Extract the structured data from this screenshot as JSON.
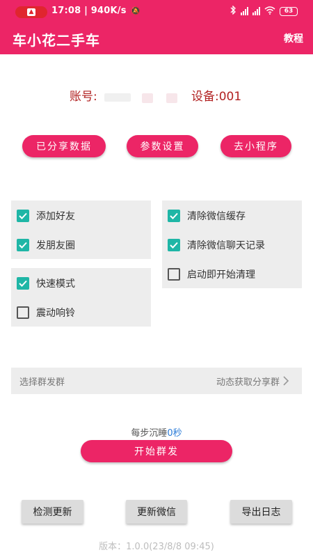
{
  "status_bar": {
    "time_speed": "17:08 | 940K/s",
    "battery": "63",
    "icons": [
      "record-icon",
      "mute-bell-icon",
      "bluetooth-icon",
      "signal-icon",
      "wifi-icon",
      "battery-icon"
    ]
  },
  "app_bar": {
    "title": "车小花二手车",
    "tutorial": "教程"
  },
  "account": {
    "label": "账号:",
    "device": "设备:001"
  },
  "actions": {
    "shared_data": "已分享数据",
    "params": "参数设置",
    "mini_program": "去小程序"
  },
  "options": {
    "panel1": [
      {
        "label": "添加好友",
        "checked": true
      },
      {
        "label": "发朋友圈",
        "checked": true
      }
    ],
    "panel2": [
      {
        "label": "清除微信缓存",
        "checked": true
      },
      {
        "label": "清除微信聊天记录",
        "checked": true
      },
      {
        "label": "启动即开始清理",
        "checked": false
      }
    ],
    "panel3": [
      {
        "label": "快速模式",
        "checked": true
      },
      {
        "label": "震动响铃",
        "checked": false
      }
    ]
  },
  "group": {
    "left": "选择群发群",
    "right": "动态获取分享群"
  },
  "sleep": {
    "prefix": "每步沉睡",
    "value": "0",
    "unit": "秒"
  },
  "start_button": "开始群发",
  "bottom": {
    "check_update": "检测更新",
    "update_wechat": "更新微信",
    "export_log": "导出日志"
  },
  "version": "版本：1.0.0(23/8/8 09:45)",
  "colors": {
    "primary": "#EC2566",
    "checkbox": "#1FB6A6",
    "account_text": "#B22222",
    "sleep_value": "#2A7BD8"
  }
}
